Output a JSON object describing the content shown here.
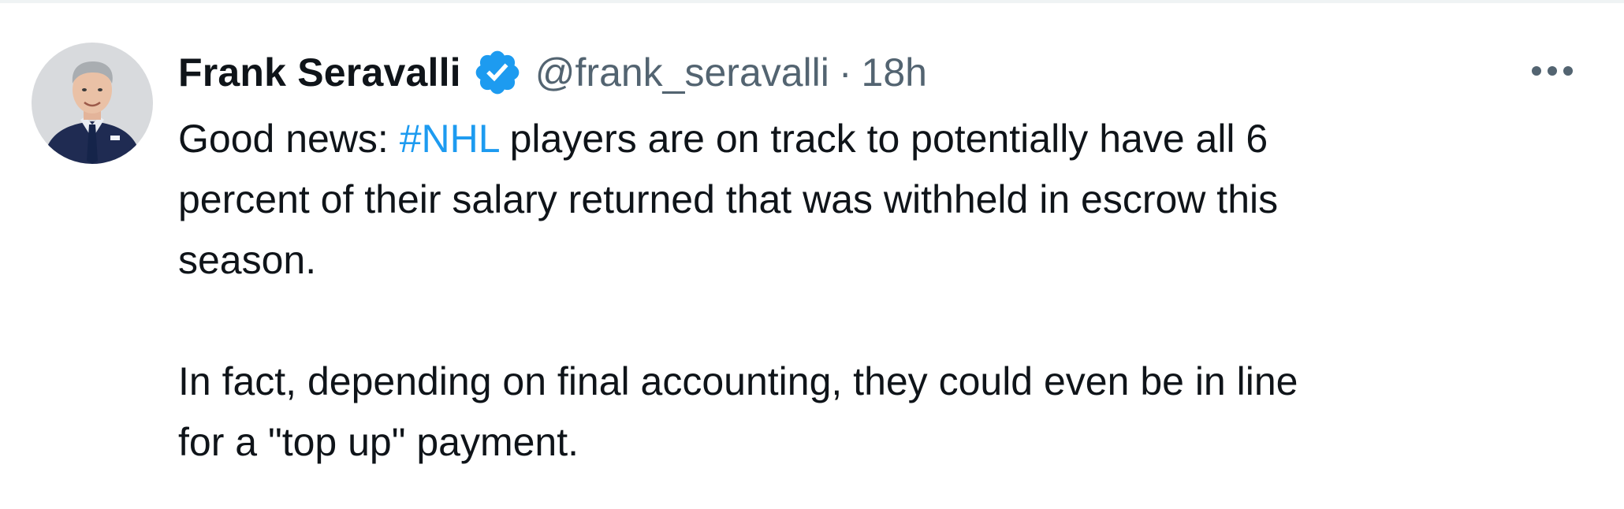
{
  "tweet": {
    "author": {
      "display_name": "Frank Seravalli",
      "verified": true,
      "handle": "@frank_seravalli",
      "avatar_icon": "profile-photo"
    },
    "separator": "·",
    "time": "18h",
    "more_icon": "more-horizontal-icon",
    "body": {
      "p1_before": "Good news: ",
      "hashtag": "#NHL",
      "p1_line1_after": " players are on track to potentially have all 6",
      "p1_line2": "percent of their salary returned that was withheld in escrow this",
      "p1_line3": "season.",
      "p2_line1": "In fact, depending on final accounting, they could even be in line",
      "p2_line2": "for a \"top up\" payment."
    },
    "colors": {
      "text": "#0f1419",
      "secondary": "#536471",
      "link": "#1d9bf0",
      "verified": "#1d9bf0"
    }
  }
}
